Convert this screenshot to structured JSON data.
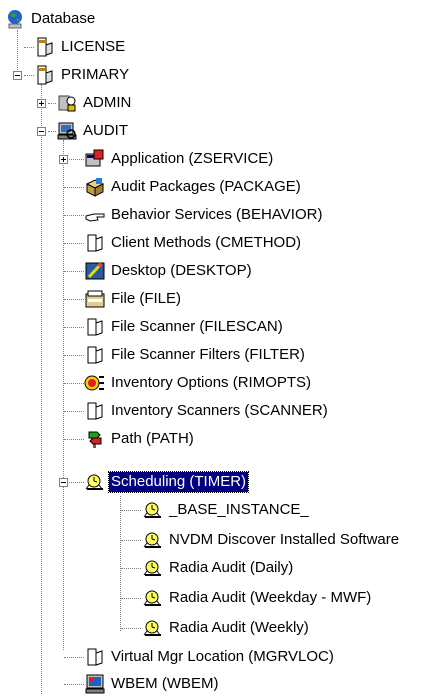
{
  "tree": {
    "root": {
      "label": "Database",
      "icon": "database-globe-icon"
    },
    "license": {
      "label": "LICENSE",
      "icon": "instance-icon"
    },
    "primary": {
      "label": "PRIMARY",
      "icon": "instance-icon",
      "expanded": true
    },
    "admin": {
      "label": "ADMIN",
      "icon": "admin-icon",
      "expanded": false
    },
    "audit": {
      "label": "AUDIT",
      "icon": "audit-computer-icon",
      "expanded": true
    },
    "audit_children": [
      {
        "label": "Application (ZSERVICE)",
        "icon": "application-icon",
        "expander": "plus"
      },
      {
        "label": "Audit Packages (PACKAGE)",
        "icon": "package-icon"
      },
      {
        "label": "Behavior Services (BEHAVIOR)",
        "icon": "hand-pointer-icon"
      },
      {
        "label": "Client Methods (CMETHOD)",
        "icon": "class-icon"
      },
      {
        "label": "Desktop (DESKTOP)",
        "icon": "desktop-icon"
      },
      {
        "label": "File (FILE)",
        "icon": "file-icon"
      },
      {
        "label": "File Scanner (FILESCAN)",
        "icon": "class-icon"
      },
      {
        "label": "File Scanner Filters (FILTER)",
        "icon": "class-icon"
      },
      {
        "label": "Inventory Options (RIMOPTS)",
        "icon": "inventory-options-icon"
      },
      {
        "label": "Inventory Scanners (SCANNER)",
        "icon": "class-icon"
      },
      {
        "label": "Path (PATH)",
        "icon": "path-icon"
      },
      {
        "label": "Scheduling (TIMER)",
        "icon": "timer-icon",
        "expander": "minus",
        "selected": true
      },
      {
        "label": "Virtual Mgr Location (MGRVLOC)",
        "icon": "class-icon"
      },
      {
        "label": "WBEM (WBEM)",
        "icon": "wbem-icon"
      }
    ],
    "timer_children": [
      {
        "label": "_BASE_INSTANCE_",
        "icon": "timer-icon"
      },
      {
        "label": "NVDM Discover Installed Software",
        "icon": "timer-icon"
      },
      {
        "label": "Radia Audit (Daily)",
        "icon": "timer-icon"
      },
      {
        "label": "Radia Audit (Weekday - MWF)",
        "icon": "timer-icon"
      },
      {
        "label": "Radia Audit (Weekly)",
        "icon": "timer-icon"
      }
    ]
  },
  "colors": {
    "selection": "#000080",
    "lines": "#808080"
  }
}
